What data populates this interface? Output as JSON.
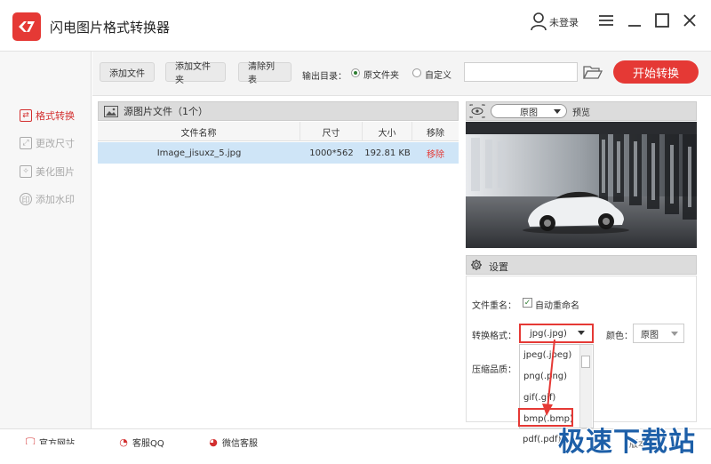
{
  "window": {
    "logo_text": "&lt;7",
    "title": "闪电图片格式转换器",
    "login": "未登录",
    "buttons": [
      "menu-icon",
      "minimize-icon",
      "maximize-icon",
      "close-icon"
    ]
  },
  "sidebar": {
    "items": [
      {
        "label": "格式转换",
        "icon": "swap-icon",
        "active": true
      },
      {
        "label": "更改尺寸",
        "icon": "resize-icon",
        "active": false
      },
      {
        "label": "美化图片",
        "icon": "beautify-icon",
        "active": false
      },
      {
        "label": "添加水印",
        "icon": "watermark-icon",
        "active": false
      }
    ]
  },
  "toolbar": {
    "add_file": "添加文件",
    "add_folder": "添加文件夹",
    "clear_list": "清除列表",
    "output_label": "输出目录：",
    "option_source": "原文件夹",
    "option_custom": "自定义",
    "path_value": "",
    "start": "开始转换"
  },
  "file_list": {
    "header": "源图片文件（1个）",
    "columns": [
      "文件名称",
      "尺寸",
      "大小",
      "移除"
    ],
    "rows": [
      {
        "name": "Image_jisuxz_5.jpg",
        "size": "1000*562",
        "bytes": "192.81 KB",
        "remove": "移除"
      }
    ]
  },
  "preview": {
    "mode": "原图",
    "label": "预览"
  },
  "settings": {
    "header": "设置",
    "rename_label": "文件重名：",
    "rename_option": "自动重命名",
    "format_label": "转换格式：",
    "format_value": "jpg(.jpg)",
    "color_label": "颜色：",
    "color_value": "原图",
    "quality_label": "压缩品质：",
    "format_options": [
      "jpeg(.jpeg)",
      "png(.png)",
      "gif(.gif)",
      "bmp(.bmp)",
      "pdf(.pdf)"
    ]
  },
  "footer": {
    "website": "官方网站",
    "qq": "客服QQ",
    "wechat": "微信客服",
    "version": "版本"
  },
  "watermark": "极速下载站",
  "colors": {
    "accent": "#e53935",
    "selected_row": "#cfe5f7"
  }
}
